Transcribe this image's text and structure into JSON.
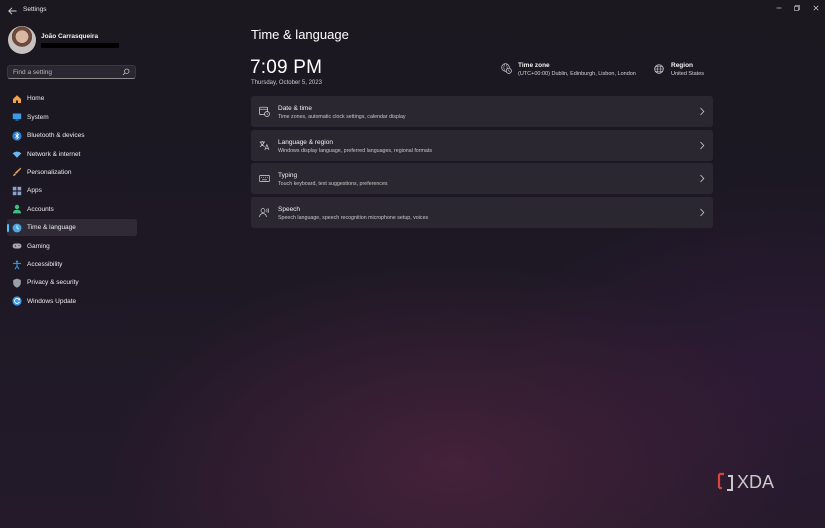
{
  "window": {
    "title": "Settings",
    "back_icon": "back-arrow-icon",
    "controls": [
      "minimize-icon",
      "maximize-icon",
      "close-icon"
    ]
  },
  "profile": {
    "name": "João Carrasqueira"
  },
  "search": {
    "placeholder": "Find a setting",
    "icon": "search-icon"
  },
  "nav": {
    "items": [
      {
        "label": "Home",
        "icon": "home-icon",
        "color": "#f0a34a"
      },
      {
        "label": "System",
        "icon": "system-icon",
        "color": "#3b9be8"
      },
      {
        "label": "Bluetooth & devices",
        "icon": "bluetooth-icon",
        "color": "#3b9be8"
      },
      {
        "label": "Network & internet",
        "icon": "wifi-icon",
        "color": "#6ab6f0"
      },
      {
        "label": "Personalization",
        "icon": "brush-icon",
        "color": "#e6a35c"
      },
      {
        "label": "Apps",
        "icon": "apps-icon",
        "color": "#8aa3c8"
      },
      {
        "label": "Accounts",
        "icon": "accounts-icon",
        "color": "#3fbf7f"
      },
      {
        "label": "Time & language",
        "icon": "time-language-icon",
        "color": "#4aa8e8",
        "selected": true
      },
      {
        "label": "Gaming",
        "icon": "gaming-icon",
        "color": "#a8a8b0"
      },
      {
        "label": "Accessibility",
        "icon": "accessibility-icon",
        "color": "#3b9be8"
      },
      {
        "label": "Privacy & security",
        "icon": "shield-icon",
        "color": "#9aa0a8"
      },
      {
        "label": "Windows Update",
        "icon": "update-icon",
        "color": "#3b9be8"
      }
    ]
  },
  "main": {
    "title": "Time & language",
    "clock": {
      "time": "7:09 PM",
      "date": "Thursday, October 5, 2023"
    },
    "time_zone": {
      "title": "Time zone",
      "value": "(UTC+00:00) Dublin, Edinburgh, Lisbon, London",
      "icon": "globe-clock-icon"
    },
    "region": {
      "title": "Region",
      "value": "United States",
      "icon": "globe-icon"
    },
    "cards": [
      {
        "title": "Date & time",
        "subtitle": "Time zones, automatic clock settings, calendar display",
        "icon": "calendar-clock-icon"
      },
      {
        "title": "Language & region",
        "subtitle": "Windows display language, preferred languages, regional formats",
        "icon": "language-icon"
      },
      {
        "title": "Typing",
        "subtitle": "Touch keyboard, text suggestions, preferences",
        "icon": "keyboard-icon"
      },
      {
        "title": "Speech",
        "subtitle": "Speech language, speech recognition microphone setup, voices",
        "icon": "speech-icon"
      }
    ]
  },
  "watermark": {
    "text": "XDA"
  },
  "colors": {
    "accent": "#4cc2ff",
    "card_bg": "#2b2730",
    "selected_bg": "#2f2b36"
  }
}
